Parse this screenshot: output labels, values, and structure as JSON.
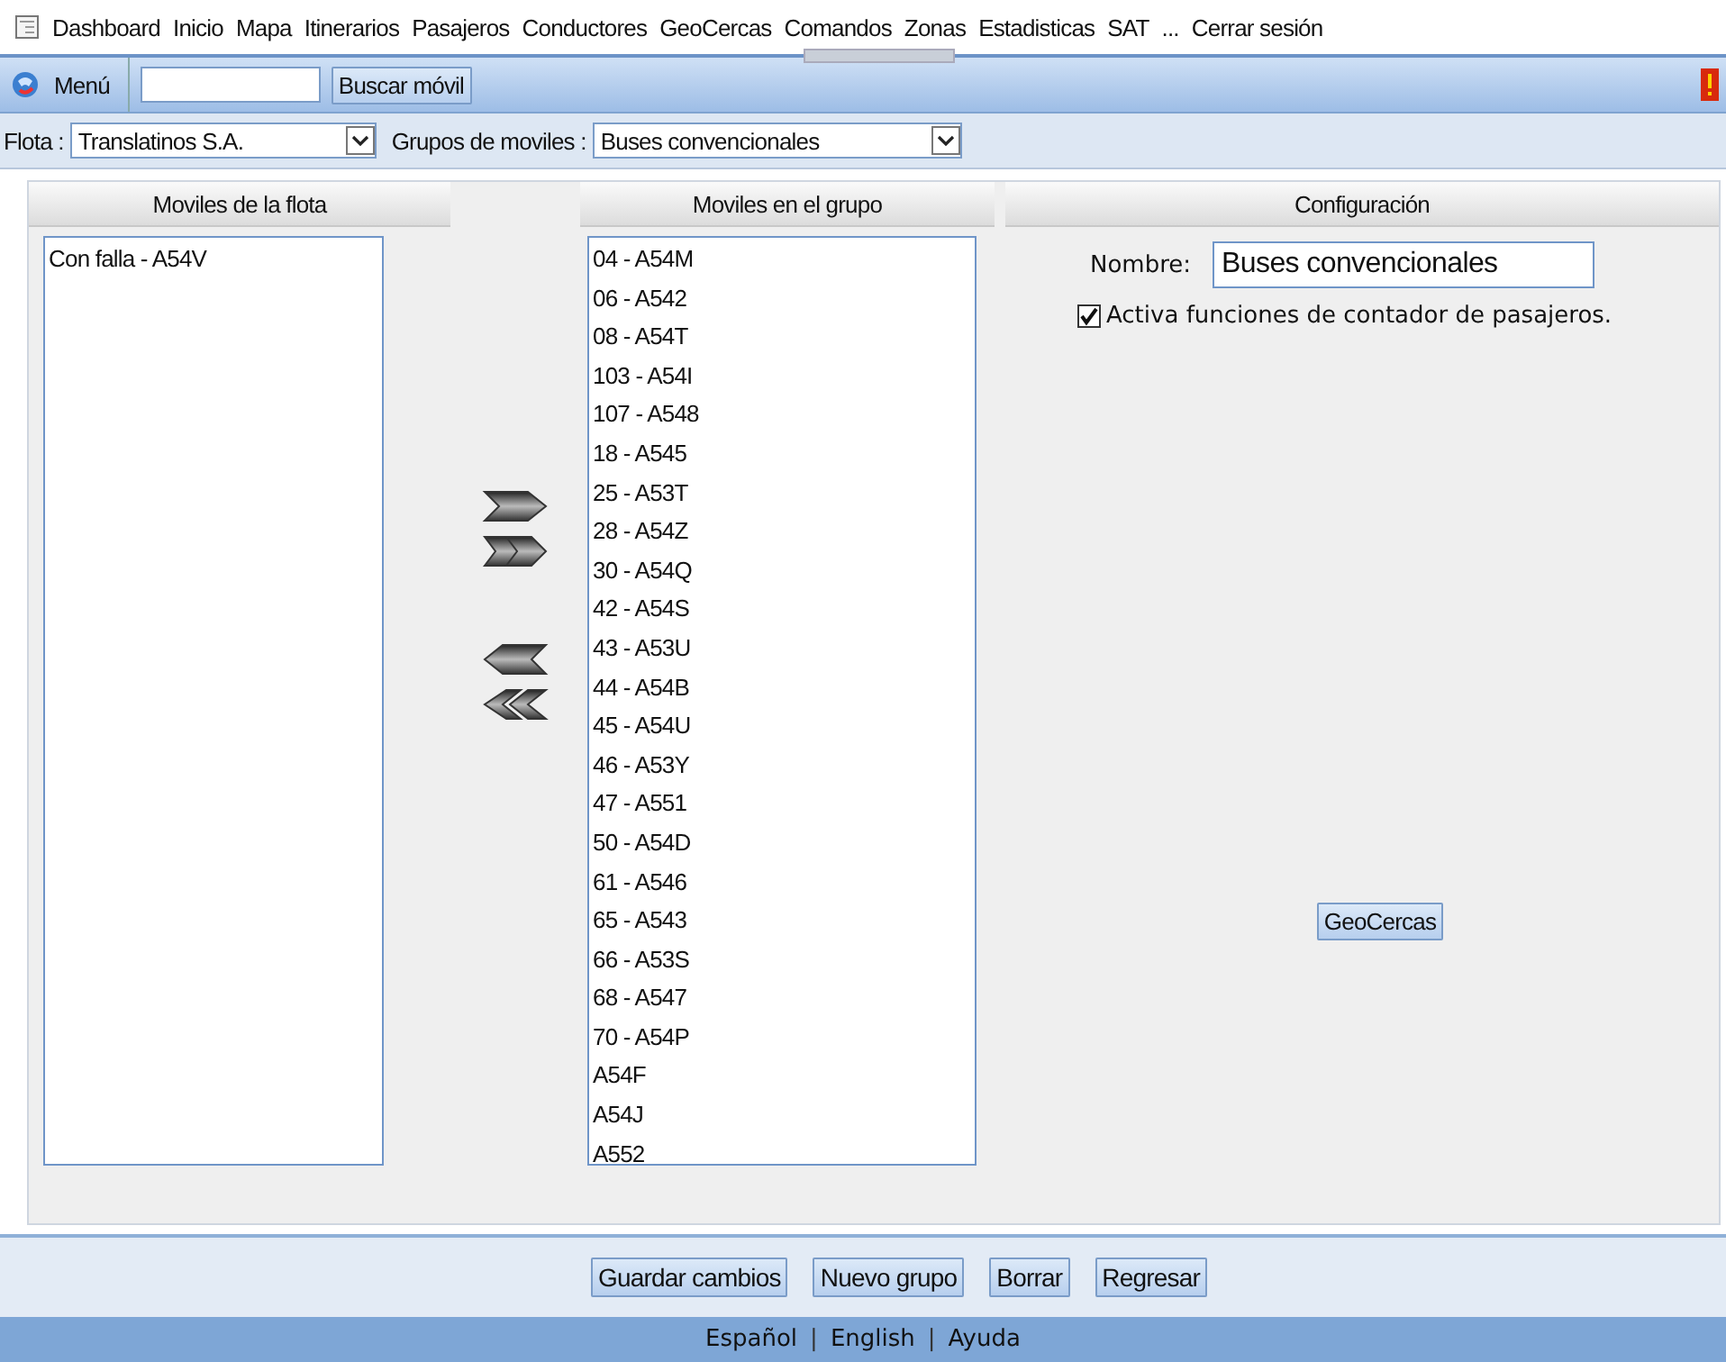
{
  "menu_bar": {
    "items": [
      "Dashboard",
      "Inicio",
      "Mapa",
      "Itinerarios",
      "Pasajeros",
      "Conductores",
      "GeoCercas",
      "Comandos",
      "Zonas",
      "Estadisticas",
      "SAT",
      "...",
      "Cerrar sesión"
    ]
  },
  "toolbar": {
    "menu_label": "Menú",
    "search_button": "Buscar móvil"
  },
  "filters": [
    {
      "label": "Flota :",
      "value": "Translatinos S.A."
    },
    {
      "label": "Grupos de moviles :",
      "value": "Buses convencionales"
    }
  ],
  "fleet_list": {
    "title": "Moviles de la flota",
    "items": [
      "Con falla - A54V"
    ]
  },
  "group_list": {
    "title": "Moviles en el grupo",
    "items": [
      "04 - A54M",
      "06 - A542",
      "08 - A54T",
      "103 - A54I",
      "107 - A548",
      "18 - A545",
      "25 - A53T",
      "28 - A54Z",
      "30 - A54Q",
      "42 - A54S",
      "43 - A53U",
      "44 - A54B",
      "45 - A54U",
      "46 - A53Y",
      "47 - A551",
      "50 - A54D",
      "61 - A546",
      "65 - A543",
      "66 - A53S",
      "68 - A547",
      "70 - A54P",
      "A54F",
      "A54J",
      "A552"
    ]
  },
  "config": {
    "title": "Configuración",
    "name_label": "Nombre:",
    "name_value": "Buses convencionales",
    "checkbox": {
      "label": "Activa funciones de contador de pasajeros.",
      "checked": true
    },
    "geocercas_button": "GeoCercas"
  },
  "actions": [
    "Guardar cambios",
    "Nuevo grupo",
    "Borrar",
    "Regresar"
  ],
  "footer": [
    {
      "kind": "link",
      "text": "Español"
    },
    {
      "kind": "sep",
      "text": "|"
    },
    {
      "kind": "link",
      "text": "English"
    },
    {
      "kind": "sep",
      "text": "|"
    },
    {
      "kind": "link",
      "text": "Ayuda"
    }
  ]
}
